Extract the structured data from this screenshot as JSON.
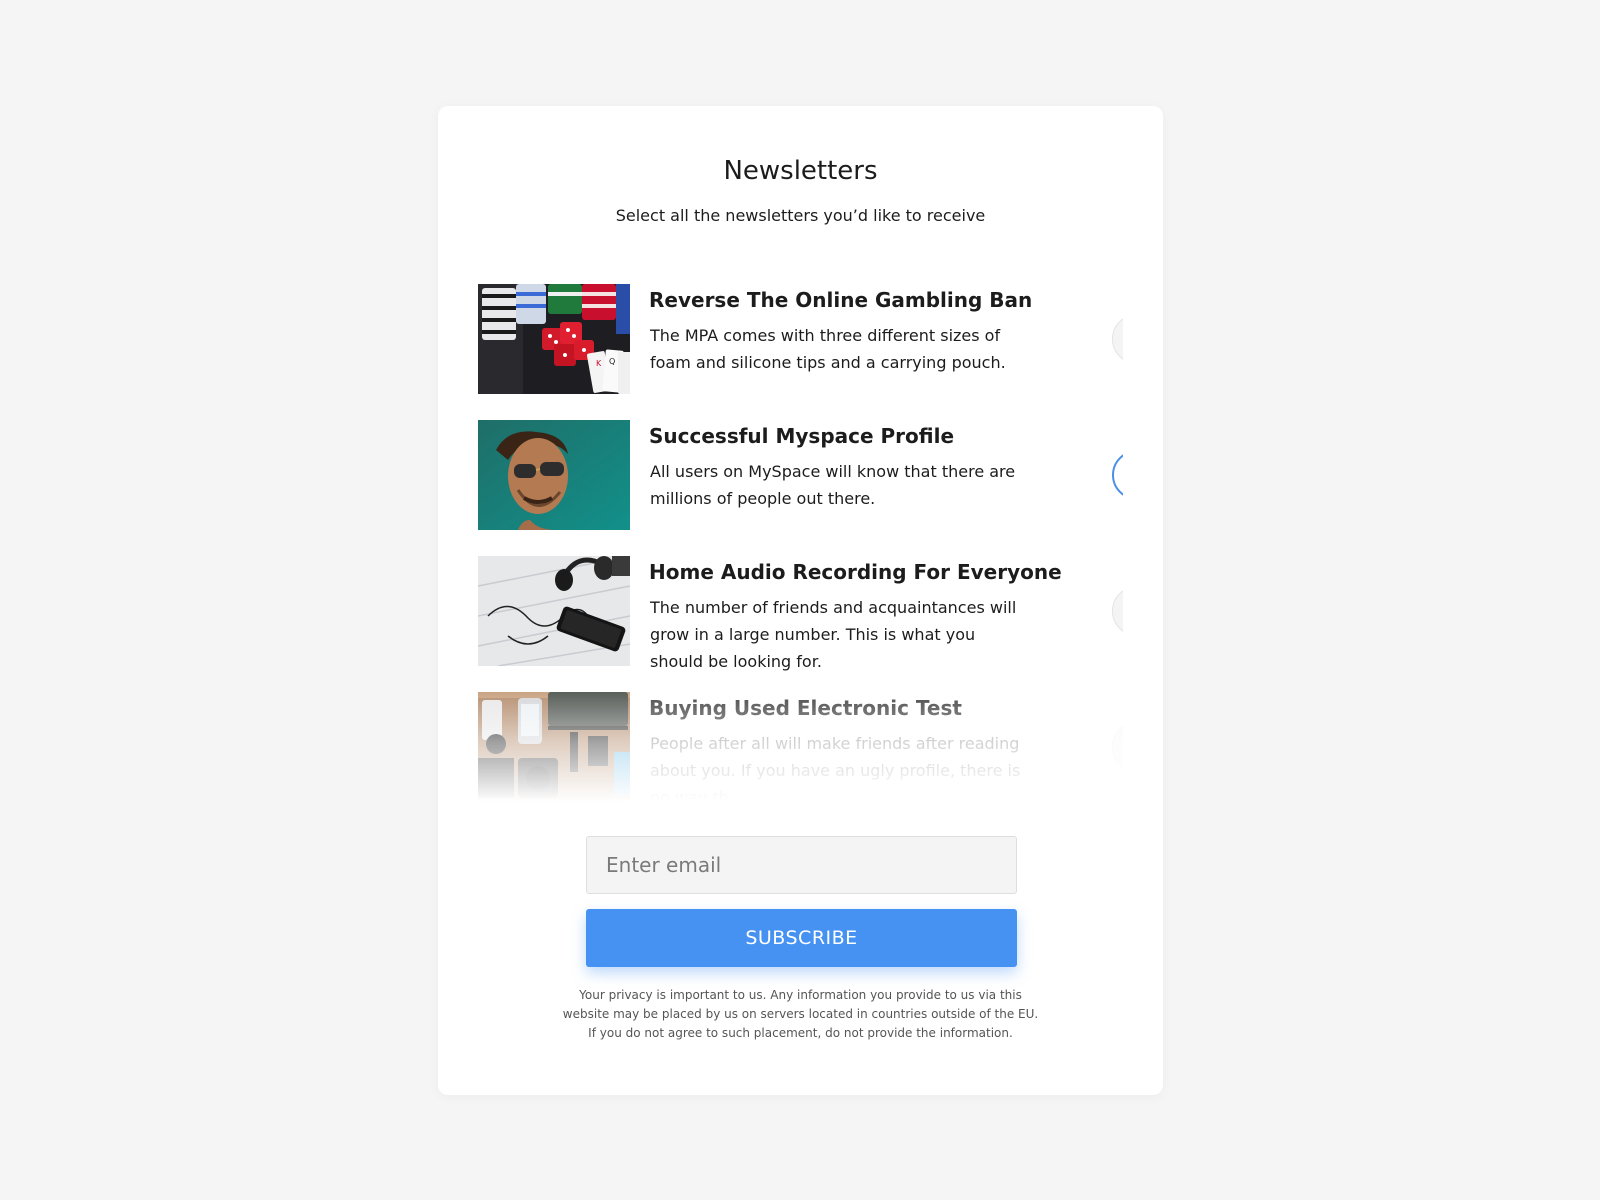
{
  "header": {
    "title": "Newsletters",
    "subtitle": "Select all the newsletters you’d like to receive"
  },
  "newsletters": [
    {
      "title": "Reverse The Online Gambling Ban",
      "description": "The MPA comes with three different sizes of foam and silicone tips and a carrying pouch.",
      "selected": false,
      "image": "casino-chips-dice-cards-image"
    },
    {
      "title": "Successful Myspace Profile",
      "description": "All users on MySpace will know that there are millions of people out there.",
      "selected": true,
      "image": "man-sunglasses-portrait-image"
    },
    {
      "title": "Home Audio Recording For Everyone",
      "description": "The number of friends and acquaintances will grow in a large number. This is what you should be looking for.",
      "selected": false,
      "image": "headphones-phone-desk-image"
    },
    {
      "title": "Buying Used Electronic Test",
      "description": "People after all will make friends after reading about you. If you have an ugly profile, there is no way th",
      "selected": false,
      "image": "electronics-flatlay-image"
    }
  ],
  "form": {
    "email_placeholder": "Enter email",
    "email_value": "",
    "subscribe_label": "SUBSCRIBE"
  },
  "privacy": {
    "line1": "Your privacy is important to us. Any information you provide to us via this",
    "line2": "website may be placed by us on servers located in countries outside of the EU.",
    "line3": "If you do not agree to such placement, do not provide the information."
  },
  "colors": {
    "accent": "#4592f2",
    "check_border": "#4a8fe8",
    "background": "#f5f5f5",
    "card": "#ffffff"
  }
}
